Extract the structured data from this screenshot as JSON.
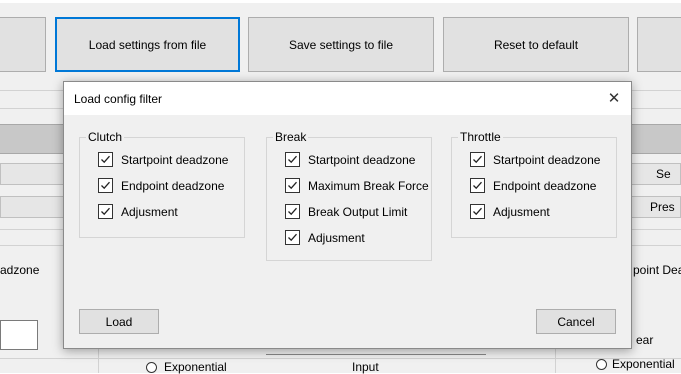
{
  "toolbar": {
    "load_label": "Load settings from file",
    "save_label": "Save settings to file",
    "reset_label": "Reset to default"
  },
  "background": {
    "left_partial_text": "adzone",
    "right_top_partial": "Se",
    "right_mid_partial": "Pres",
    "right_partial_text": "point Dea",
    "right_ear": "ear",
    "exponential_left": "Exponential",
    "input_label": "Input",
    "exponential_right": "Exponential"
  },
  "dialog": {
    "title": "Load config filter",
    "groups": {
      "clutch": {
        "title": "Clutch",
        "items": [
          "Startpoint deadzone",
          "Endpoint deadzone",
          "Adjusment"
        ]
      },
      "break": {
        "title": "Break",
        "items": [
          "Startpoint deadzone",
          "Maximum Break Force",
          "Break Output Limit",
          "Adjusment"
        ]
      },
      "throttle": {
        "title": "Throttle",
        "items": [
          "Startpoint deadzone",
          "Endpoint deadzone",
          "Adjusment"
        ]
      }
    },
    "load_label": "Load",
    "cancel_label": "Cancel"
  },
  "colors": {
    "focus_border": "#0078d7",
    "button_face": "#e1e1e1",
    "window_bg": "#f0f0f0"
  }
}
